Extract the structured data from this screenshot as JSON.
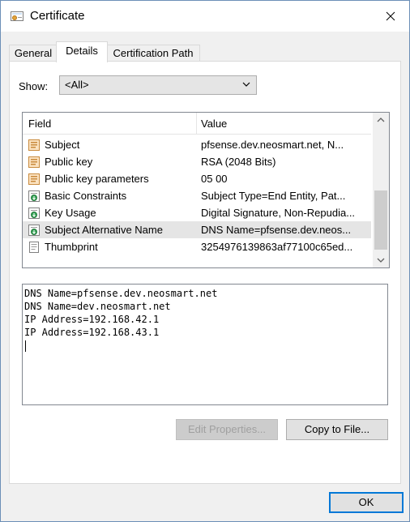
{
  "window": {
    "title": "Certificate"
  },
  "tabs": [
    {
      "label": "General"
    },
    {
      "label": "Details"
    },
    {
      "label": "Certification Path"
    }
  ],
  "show": {
    "label": "Show:",
    "selected": "<All>"
  },
  "list": {
    "headers": {
      "field": "Field",
      "value": "Value"
    },
    "rows": [
      {
        "field": "Subject",
        "value": "pfsense.dev.neosmart.net, N...",
        "icon": "cert-field-icon"
      },
      {
        "field": "Public key",
        "value": "RSA (2048 Bits)",
        "icon": "cert-field-icon"
      },
      {
        "field": "Public key parameters",
        "value": "05 00",
        "icon": "cert-field-icon"
      },
      {
        "field": "Basic Constraints",
        "value": "Subject Type=End Entity, Pat...",
        "icon": "extension-icon"
      },
      {
        "field": "Key Usage",
        "value": "Digital Signature, Non-Repudia...",
        "icon": "extension-icon"
      },
      {
        "field": "Subject Alternative Name",
        "value": "DNS Name=pfsense.dev.neos...",
        "icon": "extension-icon"
      },
      {
        "field": "Thumbprint",
        "value": "3254976139863af77100c65ed...",
        "icon": "document-icon"
      }
    ],
    "selected_index": 5
  },
  "details": {
    "lines": [
      "DNS Name=pfsense.dev.neosmart.net",
      "DNS Name=dev.neosmart.net",
      "IP Address=192.168.42.1",
      "IP Address=192.168.43.1"
    ]
  },
  "buttons": {
    "edit_properties": "Edit Properties...",
    "copy_to_file": "Copy to File...",
    "ok": "OK"
  },
  "colors": {
    "accent": "#0078d7",
    "selected_row": "#e5e5e5"
  }
}
